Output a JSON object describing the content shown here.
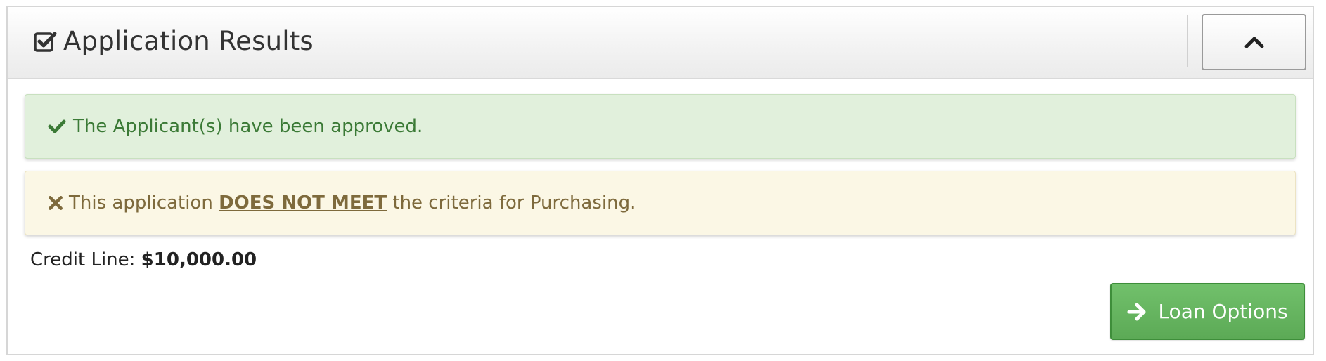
{
  "panel": {
    "title": "Application Results",
    "header_icon": "check-square-icon",
    "collapse_icon": "chevron-up-icon"
  },
  "alerts": {
    "success": {
      "icon": "check-icon",
      "text": "The Applicant(s) have been approved.",
      "color": "#3b7a36",
      "background": "#e1f0dc"
    },
    "warning": {
      "icon": "times-icon",
      "prefix": "This application",
      "emphasis": "DOES NOT MEET",
      "suffix": "the criteria for Purchasing.",
      "color": "#7e6a3c",
      "background": "#fbf7e5"
    }
  },
  "credit": {
    "label": "Credit Line:",
    "value": "$10,000.00"
  },
  "actions": {
    "loan_options_label": "Loan Options",
    "loan_options_icon": "arrow-right-icon",
    "accent": "#5cb85c"
  }
}
